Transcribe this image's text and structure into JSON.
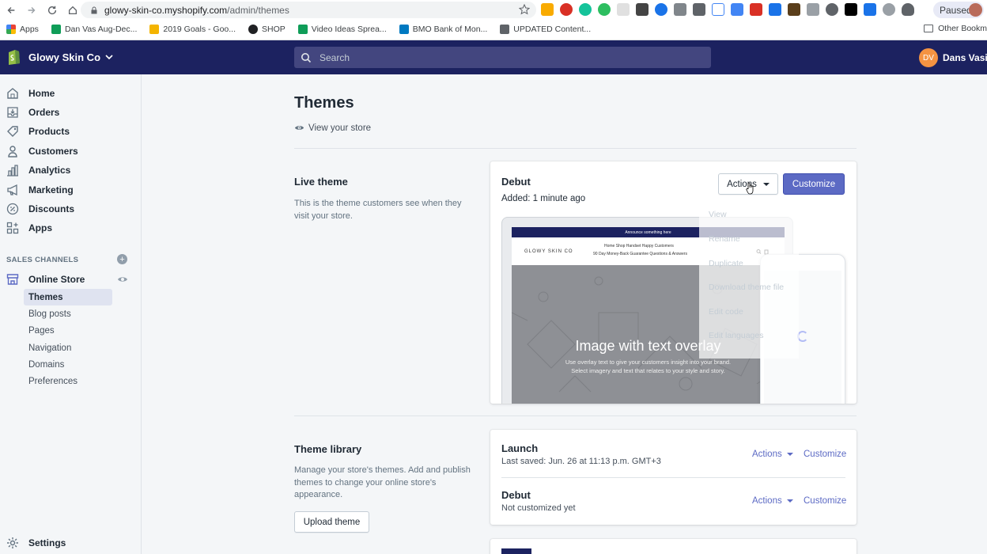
{
  "browser": {
    "url_host": "glowy-skin-co.myshopify.com",
    "url_path": "/admin/themes",
    "paused_label": "Paused",
    "bookmarks": [
      {
        "label": "Apps",
        "icon": "apps-grid-icon",
        "color": "#e8453c"
      },
      {
        "label": "Dan Vas Aug-Dec...",
        "icon": "sheets-icon",
        "color": "#0f9d58"
      },
      {
        "label": "2019 Goals - Goo...",
        "icon": "drive-icon",
        "color": "#f4b400"
      },
      {
        "label": "SHOP",
        "icon": "shop-icon",
        "color": "#202124"
      },
      {
        "label": "Video Ideas Sprea...",
        "icon": "sheets-icon",
        "color": "#0f9d58"
      },
      {
        "label": "BMO Bank of Mon...",
        "icon": "bank-icon",
        "color": "#0079c1"
      },
      {
        "label": "UPDATED Content...",
        "icon": "doc-icon",
        "color": "#5f6368"
      }
    ],
    "other_bookmarks": "Other Bookm"
  },
  "topbar": {
    "store_name": "Glowy Skin Co",
    "search_placeholder": "Search",
    "user_initials": "DV",
    "user_name": "Dans Vasilj"
  },
  "sidebar": {
    "items": [
      {
        "label": "Home",
        "icon": "home-icon"
      },
      {
        "label": "Orders",
        "icon": "orders-icon"
      },
      {
        "label": "Products",
        "icon": "products-icon"
      },
      {
        "label": "Customers",
        "icon": "customers-icon"
      },
      {
        "label": "Analytics",
        "icon": "analytics-icon"
      },
      {
        "label": "Marketing",
        "icon": "marketing-icon"
      },
      {
        "label": "Discounts",
        "icon": "discounts-icon"
      },
      {
        "label": "Apps",
        "icon": "apps-icon"
      }
    ],
    "sales_channels_label": "SALES CHANNELS",
    "online_store_label": "Online Store",
    "sub_items": [
      {
        "label": "Themes",
        "active": true
      },
      {
        "label": "Blog posts",
        "active": false
      },
      {
        "label": "Pages",
        "active": false
      },
      {
        "label": "Navigation",
        "active": false
      },
      {
        "label": "Domains",
        "active": false
      },
      {
        "label": "Preferences",
        "active": false
      }
    ],
    "settings_label": "Settings"
  },
  "main": {
    "title": "Themes",
    "view_store": "View your store",
    "live_theme": {
      "section_title": "Live theme",
      "section_desc": "This is the theme customers see when they visit your store.",
      "name": "Debut",
      "added": "Added: 1 minute ago",
      "actions_label": "Actions",
      "customize_label": "Customize",
      "dropdown": [
        "View",
        "Rename",
        "Duplicate",
        "Download theme file",
        "Edit code",
        "Edit languages"
      ],
      "preview": {
        "announcement": "Announce something here",
        "brand": "GLOWY SKIN CO",
        "nav_line1": "Home   Shop Handset   Happy Customers",
        "nav_line2": "90 Day Money-Back Guarantee   Questions & Answers",
        "hero_title": "Image with text overlay",
        "hero_sub1": "Use overlay text to give your customers insight into your brand.",
        "hero_sub2": "Select imagery and text that relates to your style and story."
      }
    },
    "library": {
      "section_title": "Theme library",
      "section_desc": "Manage your store's themes. Add and publish themes to change your online store's appearance.",
      "upload_label": "Upload theme",
      "themes": [
        {
          "name": "Launch",
          "meta": "Last saved: Jun. 26 at 11:13 p.m. GMT+3",
          "actions": "Actions",
          "customize": "Customize"
        },
        {
          "name": "Debut",
          "meta": "Not customized yet",
          "actions": "Actions",
          "customize": "Customize"
        }
      ]
    }
  },
  "colors": {
    "topbar": "#1c2260",
    "accent": "#5c6ac4",
    "avatar": "#f49342"
  }
}
